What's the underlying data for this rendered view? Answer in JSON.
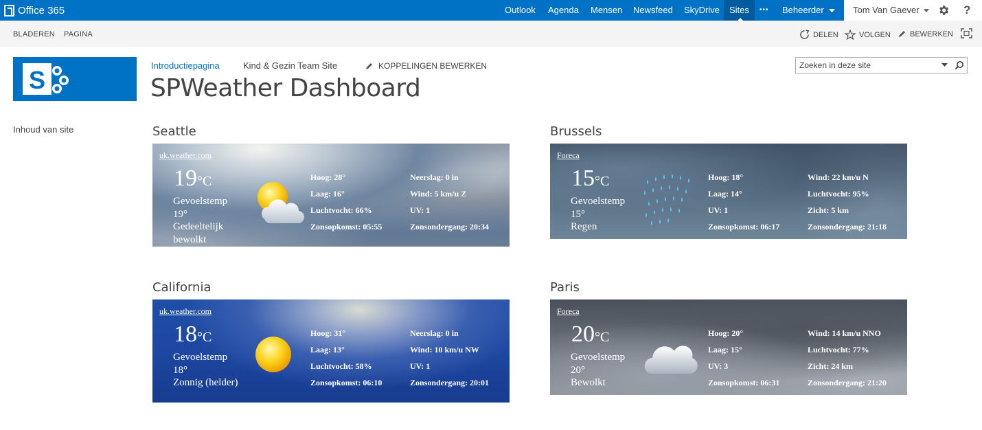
{
  "suite": {
    "brand": "Office 365",
    "links": [
      "Outlook",
      "Agenda",
      "Mensen",
      "Newsfeed",
      "SkyDrive",
      "Sites"
    ],
    "more": "•••",
    "admin": "Beheerder",
    "user": "Tom Van Gaever",
    "help": "?"
  },
  "ribbon": {
    "tabs": [
      "BLADEREN",
      "PAGINA"
    ],
    "share": "DELEN",
    "follow": "VOLGEN",
    "edit": "BEWERKEN"
  },
  "header": {
    "breadcrumb": [
      "Introductiepagina",
      "Kind & Gezin Team Site"
    ],
    "edit_links": "KOPPELINGEN BEWERKEN",
    "title": "SPWeather Dashboard",
    "search_placeholder": "Zoeken in deze site"
  },
  "leftnav": {
    "site_contents": "Inhoud van site"
  },
  "colors": {
    "brand": "#0072c6",
    "sites_active": "#005a9e"
  },
  "weather": [
    {
      "city": "Seattle",
      "source": "uk.weather.com",
      "temp": "19",
      "unit": "°C",
      "feel_label": "Gevoelstemp",
      "feel": "19°",
      "condition": "Gedeeltelijk bewolkt",
      "icon": "partly-cloudy-icon",
      "left": [
        "Hoog: 28°",
        "Laag: 16°",
        "Luchtvocht: 66%",
        "Zonsopkomst: 05:55"
      ],
      "right": [
        "Neerslag: 0 in",
        "Wind: 5 km/u Z",
        "UV: 1",
        "Zonsondergang: 20:34"
      ]
    },
    {
      "city": "Brussels",
      "source": "Foreca",
      "temp": "15",
      "unit": "°C",
      "feel_label": "Gevoelstemp",
      "feel": "15°",
      "condition": "Regen",
      "icon": "rain-icon",
      "left": [
        "Hoog: 18°",
        "Laag: 14°",
        "UV: 1",
        "Zonsopkomst: 06:17"
      ],
      "right": [
        "Wind: 22 km/u N",
        "Luchtvocht: 95%",
        "Zicht: 5 km",
        "Zonsondergang: 21:18"
      ]
    },
    {
      "city": "California",
      "source": "uk.weather.com",
      "temp": "18",
      "unit": "°C",
      "feel_label": "Gevoelstemp",
      "feel": "18°",
      "condition": "Zonnig (helder)",
      "icon": "sun-icon",
      "left": [
        "Hoog: 31°",
        "Laag: 13°",
        "Luchtvocht: 58%",
        "Zonsopkomst: 06:10"
      ],
      "right": [
        "Neerslag: 0 in",
        "Wind: 10 km/u NW",
        "UV: 1",
        "Zonsondergang: 20:01"
      ]
    },
    {
      "city": "Paris",
      "source": "Foreca",
      "temp": "20",
      "unit": "°C",
      "feel_label": "Gevoelstemp",
      "feel": "20°",
      "condition": "Bewolkt",
      "icon": "cloud-icon",
      "left": [
        "Hoog: 20°",
        "Laag: 15°",
        "UV: 3",
        "Zonsopkomst: 06:31"
      ],
      "right": [
        "Wind: 14 km/u NNO",
        "Luchtvocht: 77%",
        "Zicht: 24 km",
        "Zonsondergang: 21:20"
      ]
    }
  ]
}
